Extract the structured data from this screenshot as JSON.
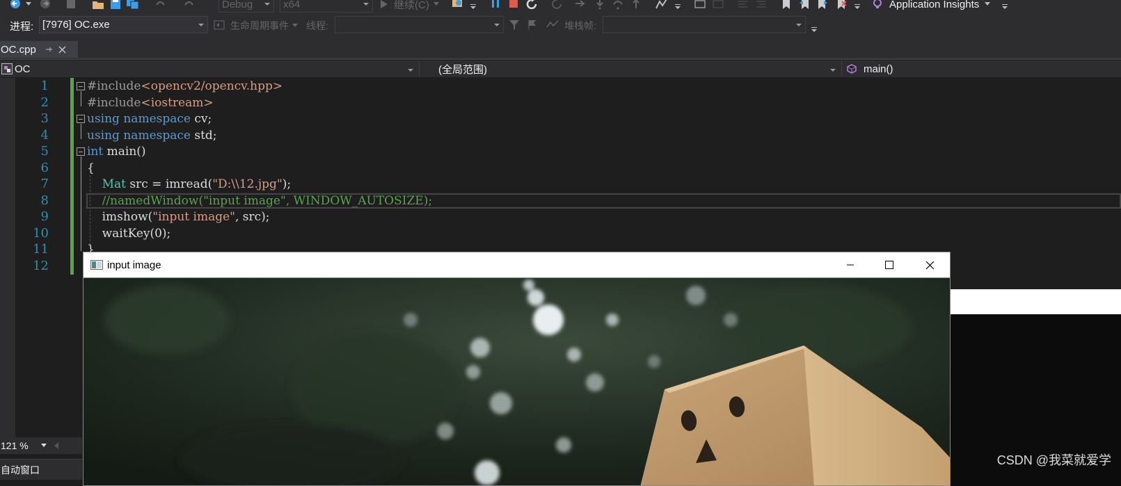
{
  "toolbar": {
    "config_combo": "Debug",
    "platform_combo": "x64",
    "continue_label": "继续(C)",
    "app_insights_label": "Application Insights"
  },
  "debug_location": {
    "process_label": "进程:",
    "process_value": "[7976] OC.exe",
    "lifecycle_label": "生命周期事件",
    "thread_label": "线程:",
    "thread_value": "",
    "stackframe_label": "堆栈帧:",
    "stackframe_value": ""
  },
  "tabs": [
    {
      "label": "OC.cpp",
      "active": true
    }
  ],
  "navbar": {
    "project": "OC",
    "scope": "(全局范围)",
    "member": "main()"
  },
  "editor": {
    "line_numbers": [
      "1",
      "2",
      "3",
      "4",
      "5",
      "6",
      "7",
      "8",
      "9",
      "10",
      "11",
      "12"
    ],
    "lines": [
      "#include<opencv2/opencv.hpp>",
      "#include<iostream>",
      "using namespace cv;",
      "using namespace std;",
      "int main()",
      "{",
      "    Mat src = imread(\"D:\\\\12.jpg\");",
      "    //namedWindow(\"input image\", WINDOW_AUTOSIZE);",
      "    imshow(\"input image\", src);",
      "    waitKey(0);",
      "}",
      ""
    ],
    "current_line": 8
  },
  "zoom": "121 %",
  "autos_window_label": "自动窗口",
  "cv_window": {
    "title": "input image"
  },
  "watermark": "CSDN @我菜就爱学",
  "colors": {
    "accent_green": "#57a64a",
    "keyword_blue": "#569cd6",
    "string_color": "#d69d85",
    "type_teal": "#4ec9b0",
    "line_number": "#2b91af",
    "stop_red": "#e05a4f",
    "pause_blue": "#3c9ee8"
  }
}
